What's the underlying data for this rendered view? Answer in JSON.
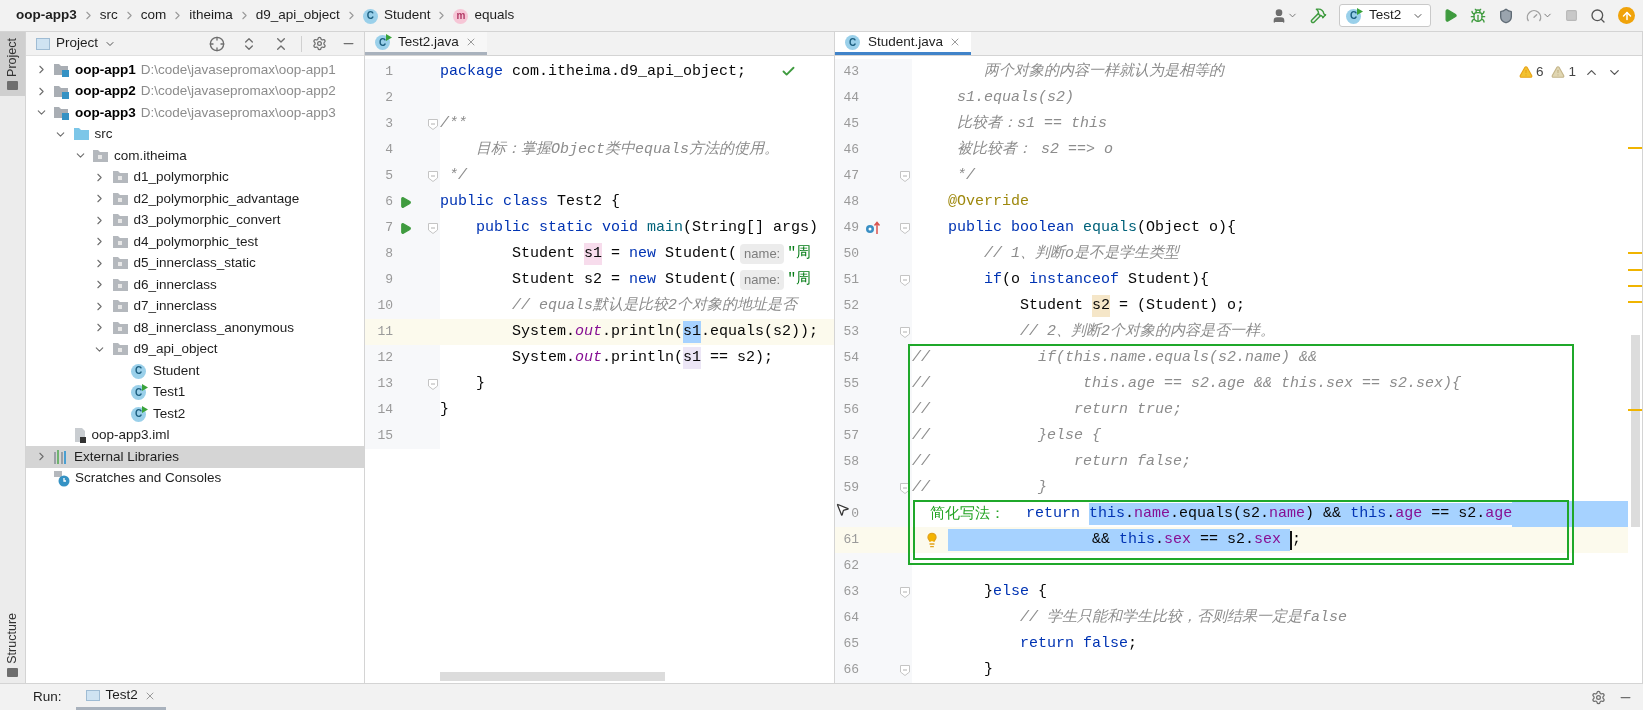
{
  "breadcrumbs": [
    {
      "kind": "project",
      "label": "oop-app3"
    },
    {
      "kind": "folder",
      "label": "src"
    },
    {
      "kind": "folder",
      "label": "com"
    },
    {
      "kind": "folder",
      "label": "itheima"
    },
    {
      "kind": "folder",
      "label": "d9_api_object"
    },
    {
      "kind": "class",
      "label": "Student",
      "icon_letter": "C"
    },
    {
      "kind": "method",
      "label": "equals",
      "icon_letter": "m"
    }
  ],
  "toolbar": {
    "run_config": "Test2",
    "run_config_letter": "C"
  },
  "side_tabs": [
    {
      "kind": "top",
      "label": "Project",
      "selected": true
    },
    {
      "kind": "bottom",
      "label": "Structure",
      "selected": false
    }
  ],
  "project_panel": {
    "title": "Project",
    "tree": [
      {
        "kind": "module",
        "label": "oop-app1",
        "path": "D:\\code\\javasepromax\\oop-app1",
        "expanded": false,
        "selected": false
      },
      {
        "kind": "module",
        "label": "oop-app2",
        "path": "D:\\code\\javasepromax\\oop-app2",
        "expanded": false,
        "selected": false
      },
      {
        "kind": "module",
        "label": "oop-app3",
        "path": "D:\\code\\javasepromax\\oop-app3",
        "expanded": true,
        "selected": false,
        "children": [
          {
            "kind": "source_folder",
            "label": "src",
            "expanded": true,
            "selected": false,
            "children": [
              {
                "kind": "package",
                "label": "com.itheima",
                "expanded": true,
                "selected": false,
                "children": [
                  {
                    "kind": "package",
                    "label": "d1_polymorphic",
                    "expanded": false,
                    "selected": false
                  },
                  {
                    "kind": "package",
                    "label": "d2_polymorphic_advantage",
                    "expanded": false,
                    "selected": false
                  },
                  {
                    "kind": "package",
                    "label": "d3_polymorphic_convert",
                    "expanded": false,
                    "selected": false
                  },
                  {
                    "kind": "package",
                    "label": "d4_polymorphic_test",
                    "expanded": false,
                    "selected": false
                  },
                  {
                    "kind": "package",
                    "label": "d5_innerclass_static",
                    "expanded": false,
                    "selected": false
                  },
                  {
                    "kind": "package",
                    "label": "d6_innerclass",
                    "expanded": false,
                    "selected": false
                  },
                  {
                    "kind": "package",
                    "label": "d7_innerclass",
                    "expanded": false,
                    "selected": false
                  },
                  {
                    "kind": "package",
                    "label": "d8_innerclass_anonymous",
                    "expanded": false,
                    "selected": false
                  },
                  {
                    "kind": "package",
                    "label": "d9_api_object",
                    "expanded": true,
                    "selected": false,
                    "children": [
                      {
                        "kind": "class",
                        "label": "Student",
                        "icon_letter": "C",
                        "selected": false
                      },
                      {
                        "kind": "runnable_class",
                        "label": "Test1",
                        "icon_letter": "C",
                        "selected": false
                      },
                      {
                        "kind": "runnable_class",
                        "label": "Test2",
                        "icon_letter": "C",
                        "selected": false
                      }
                    ]
                  }
                ]
              }
            ]
          },
          {
            "kind": "file",
            "label": "oop-app3.iml",
            "selected": false
          }
        ]
      },
      {
        "kind": "libraries",
        "label": "External Libraries",
        "expanded": false,
        "selected": true
      },
      {
        "kind": "scratches",
        "label": "Scratches and Consoles",
        "selected": false
      }
    ]
  },
  "editors": [
    {
      "focused": false,
      "analysis_ok": true,
      "tab": {
        "label": "Test2.java",
        "icon_letter": "C",
        "runnable": true,
        "selected": true
      },
      "lines": [
        {
          "number": "1",
          "current": false,
          "tokens": [
            {
              "kind": "kw",
              "text": "package"
            },
            {
              "kind": "plain",
              "text": " com.itheima.d9_api_object;"
            }
          ]
        },
        {
          "number": "2",
          "current": false
        },
        {
          "number": "3",
          "current": false,
          "fold": true,
          "tokens": [
            {
              "kind": "comment",
              "text": "/**"
            }
          ]
        },
        {
          "number": "4",
          "current": false,
          "tokens": [
            {
              "kind": "comment",
              "text": "    目标：掌握Object类中equals方法的使用。"
            }
          ]
        },
        {
          "number": "5",
          "current": false,
          "fold": true,
          "tokens": [
            {
              "kind": "comment",
              "text": " */"
            }
          ]
        },
        {
          "number": "6",
          "current": false,
          "gutter": {
            "kind": "run"
          },
          "tokens": [
            {
              "kind": "kw",
              "text": "public class"
            },
            {
              "kind": "plain",
              "text": " Test2 {"
            }
          ]
        },
        {
          "number": "7",
          "current": false,
          "gutter": {
            "kind": "run"
          },
          "fold": true,
          "tokens": [
            {
              "kind": "kw",
              "text": "    public static void"
            },
            {
              "kind": "method",
              "text": " main"
            },
            {
              "kind": "plain",
              "text": "(String[] args)"
            }
          ]
        },
        {
          "number": "8",
          "current": false,
          "tokens": [
            {
              "kind": "plain",
              "text": "        Student "
            },
            {
              "kind": "plain",
              "text": "s1",
              "highlight": {
                "kind": "write"
              }
            },
            {
              "kind": "plain",
              "text": " = "
            },
            {
              "kind": "kw",
              "text": "new"
            },
            {
              "kind": "plain",
              "text": " Student("
            },
            {
              "kind": "hint",
              "text": "name:"
            },
            {
              "kind": "string",
              "text": "\"周"
            }
          ]
        },
        {
          "number": "9",
          "current": false,
          "tokens": [
            {
              "kind": "plain",
              "text": "        Student s2 = "
            },
            {
              "kind": "kw",
              "text": "new"
            },
            {
              "kind": "plain",
              "text": " Student("
            },
            {
              "kind": "hint",
              "text": "name:"
            },
            {
              "kind": "string",
              "text": "\"周"
            }
          ]
        },
        {
          "number": "10",
          "current": false,
          "tokens": [
            {
              "kind": "comment",
              "text": "        // equals默认是比较2个对象的地址是否"
            }
          ]
        },
        {
          "number": "11",
          "current": true,
          "tokens": [
            {
              "kind": "plain",
              "text": "        System."
            },
            {
              "kind": "static_field",
              "text": "out"
            },
            {
              "kind": "plain",
              "text": ".println("
            },
            {
              "kind": "plain",
              "text": "s1",
              "highlight": {
                "kind": "caret"
              }
            },
            {
              "kind": "plain",
              "text": ".equals(s2));"
            }
          ]
        },
        {
          "number": "12",
          "current": false,
          "tokens": [
            {
              "kind": "plain",
              "text": "        System."
            },
            {
              "kind": "static_field",
              "text": "out"
            },
            {
              "kind": "plain",
              "text": ".println("
            },
            {
              "kind": "plain",
              "text": "s1",
              "highlight": {
                "kind": "read"
              }
            },
            {
              "kind": "plain",
              "text": " == s2);"
            }
          ]
        },
        {
          "number": "13",
          "current": false,
          "fold": true,
          "tokens": [
            {
              "kind": "plain",
              "text": "    }"
            }
          ]
        },
        {
          "number": "14",
          "current": false,
          "tokens": [
            {
              "kind": "plain",
              "text": "}"
            }
          ]
        },
        {
          "number": "15",
          "current": false
        }
      ]
    },
    {
      "focused": true,
      "tab": {
        "label": "Student.java",
        "icon_letter": "C",
        "runnable": false,
        "selected": true
      },
      "inspections": [
        {
          "kind": "warning",
          "count": "6"
        },
        {
          "kind": "weak_warning",
          "count": "1"
        }
      ],
      "lines": [
        {
          "number": "43",
          "current": false,
          "tokens": [
            {
              "kind": "comment",
              "text": "        两个对象的内容一样就认为是相等的"
            }
          ]
        },
        {
          "number": "44",
          "current": false,
          "tokens": [
            {
              "kind": "comment",
              "text": "     s1.equals(s2)"
            }
          ]
        },
        {
          "number": "45",
          "current": false,
          "tokens": [
            {
              "kind": "comment",
              "text": "     比较者：s1 == this"
            }
          ]
        },
        {
          "number": "46",
          "current": false,
          "tokens": [
            {
              "kind": "comment",
              "text": "     被比较者： s2 ==> o"
            }
          ]
        },
        {
          "number": "47",
          "current": false,
          "fold": true,
          "tokens": [
            {
              "kind": "comment",
              "text": "     */"
            }
          ]
        },
        {
          "number": "48",
          "current": false,
          "tokens": [
            {
              "kind": "annotation",
              "text": "    @Override"
            }
          ]
        },
        {
          "number": "49",
          "current": false,
          "gutter": {
            "kind": "override"
          },
          "fold": true,
          "tokens": [
            {
              "kind": "kw",
              "text": "    public boolean"
            },
            {
              "kind": "method",
              "text": " equals"
            },
            {
              "kind": "plain",
              "text": "(Object o){"
            }
          ]
        },
        {
          "number": "50",
          "current": false,
          "tokens": [
            {
              "kind": "comment",
              "text": "        // 1、判断o是不是学生类型"
            }
          ]
        },
        {
          "number": "51",
          "current": false,
          "fold": true,
          "tokens": [
            {
              "kind": "kw",
              "text": "        if"
            },
            {
              "kind": "plain",
              "text": "(o "
            },
            {
              "kind": "kw",
              "text": "instanceof"
            },
            {
              "kind": "plain",
              "text": " Student){"
            }
          ]
        },
        {
          "number": "52",
          "current": false,
          "tokens": [
            {
              "kind": "plain",
              "text": "            Student "
            },
            {
              "kind": "plain",
              "text": "s2",
              "highlight": {
                "kind": "declaration"
              }
            },
            {
              "kind": "plain",
              "text": " = (Student) o;"
            }
          ]
        },
        {
          "number": "53",
          "current": false,
          "fold": true,
          "tokens": [
            {
              "kind": "comment",
              "text": "            // 2、判断2个对象的内容是否一样。"
            }
          ]
        },
        {
          "number": "54",
          "current": false,
          "frames": [
            {
              "kind": "outer"
            }
          ],
          "tokens": [
            {
              "kind": "comment",
              "text": "//            if(this.name.equals(s2.name) &&"
            }
          ]
        },
        {
          "number": "55",
          "current": false,
          "frames": [
            {
              "kind": "outer"
            }
          ],
          "tokens": [
            {
              "kind": "comment",
              "text": "//                 this.age == s2.age && this.sex == s2.sex){"
            }
          ]
        },
        {
          "number": "56",
          "current": false,
          "frames": [
            {
              "kind": "outer"
            }
          ],
          "tokens": [
            {
              "kind": "comment",
              "text": "//                return true;"
            }
          ]
        },
        {
          "number": "57",
          "current": false,
          "frames": [
            {
              "kind": "outer"
            }
          ],
          "tokens": [
            {
              "kind": "comment",
              "text": "//            }else {"
            }
          ]
        },
        {
          "number": "58",
          "current": false,
          "frames": [
            {
              "kind": "outer"
            }
          ],
          "tokens": [
            {
              "kind": "comment",
              "text": "//                return false;"
            }
          ]
        },
        {
          "number": "59",
          "current": false,
          "fold": true,
          "frames": [
            {
              "kind": "outer"
            }
          ],
          "tokens": [
            {
              "kind": "comment",
              "text": "//            }"
            }
          ]
        },
        {
          "number": "0",
          "current": false,
          "frames": [
            {
              "kind": "outer"
            },
            {
              "kind": "inner"
            }
          ],
          "selection_to_end": true,
          "tokens": [
            {
              "kind": "label",
              "text": "简化写法："
            },
            {
              "kind": "kw",
              "text": "return "
            },
            {
              "kind": "kw",
              "text": "this",
              "selected": true
            },
            {
              "kind": "plain",
              "text": ".",
              "selected": true
            },
            {
              "kind": "field",
              "text": "name",
              "selected": true
            },
            {
              "kind": "plain",
              "text": ".equals(s2.",
              "selected": true
            },
            {
              "kind": "field",
              "text": "name",
              "selected": true
            },
            {
              "kind": "plain",
              "text": ") && ",
              "selected": true
            },
            {
              "kind": "kw",
              "text": "this",
              "selected": true
            },
            {
              "kind": "plain",
              "text": ".",
              "selected": true
            },
            {
              "kind": "field",
              "text": "age",
              "selected": true
            },
            {
              "kind": "plain",
              "text": " == s2.",
              "selected": true
            },
            {
              "kind": "field",
              "text": "age",
              "selected": true
            }
          ]
        },
        {
          "number": "61",
          "current": true,
          "bulb": true,
          "caret": true,
          "frames": [
            {
              "kind": "outer"
            },
            {
              "kind": "inner"
            }
          ],
          "tokens": [
            {
              "kind": "plain",
              "text": "                && ",
              "selected": true
            },
            {
              "kind": "kw",
              "text": "this",
              "selected": true
            },
            {
              "kind": "plain",
              "text": ".",
              "selected": true
            },
            {
              "kind": "field",
              "text": "sex",
              "selected": true
            },
            {
              "kind": "plain",
              "text": " == s2.",
              "selected": true
            },
            {
              "kind": "field",
              "text": "sex ",
              "selected": true
            },
            {
              "kind": "plain",
              "text": ";"
            }
          ]
        },
        {
          "number": "62",
          "current": false
        },
        {
          "number": "63",
          "current": false,
          "fold": true,
          "tokens": [
            {
              "kind": "plain",
              "text": "        }"
            },
            {
              "kind": "kw",
              "text": "else"
            },
            {
              "kind": "plain",
              "text": " {"
            }
          ]
        },
        {
          "number": "64",
          "current": false,
          "tokens": [
            {
              "kind": "comment",
              "text": "            // 学生只能和学生比较，否则结果一定是false"
            }
          ]
        },
        {
          "number": "65",
          "current": false,
          "tokens": [
            {
              "kind": "kw",
              "text": "            return false"
            },
            {
              "kind": "plain",
              "text": ";"
            }
          ]
        },
        {
          "number": "66",
          "current": false,
          "fold": true,
          "tokens": [
            {
              "kind": "plain",
              "text": "        }"
            }
          ]
        }
      ]
    }
  ],
  "run_panel": {
    "label": "Run:",
    "tabs": [
      {
        "label": "Test2",
        "selected": true
      }
    ]
  }
}
